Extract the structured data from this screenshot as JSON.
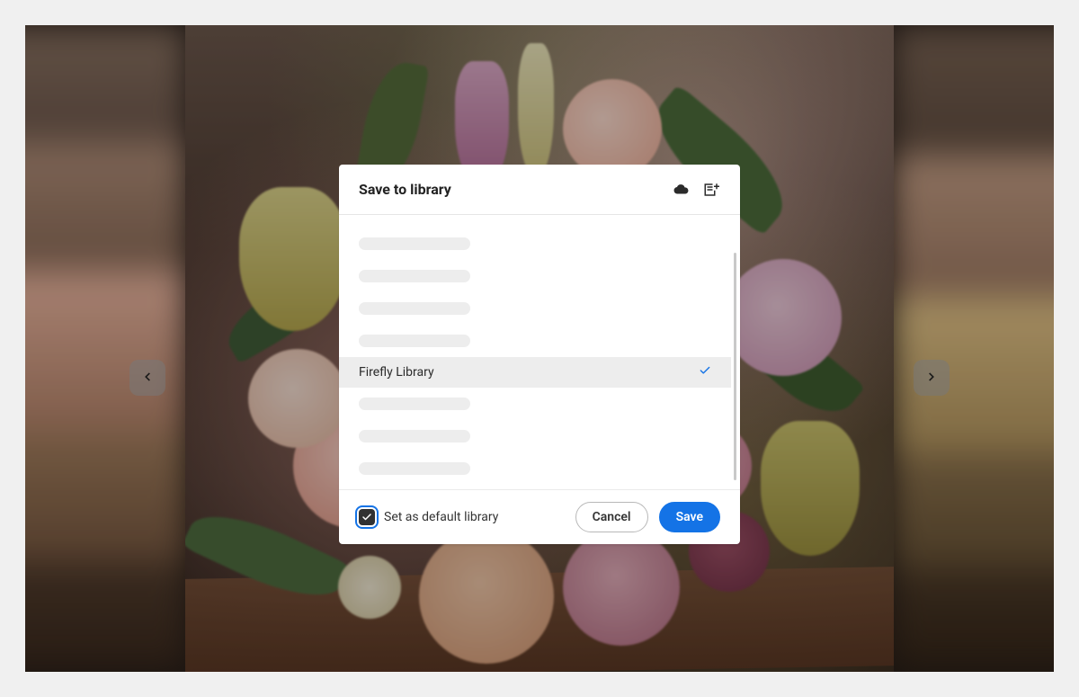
{
  "modal": {
    "title": "Save to library",
    "selected_library": "Firefly Library",
    "default_checkbox_label": "Set as default library",
    "default_checkbox_checked": true,
    "cancel_label": "Cancel",
    "save_label": "Save"
  },
  "colors": {
    "accent": "#1473e6",
    "modal_bg": "#ffffff",
    "placeholder": "#ededed"
  }
}
